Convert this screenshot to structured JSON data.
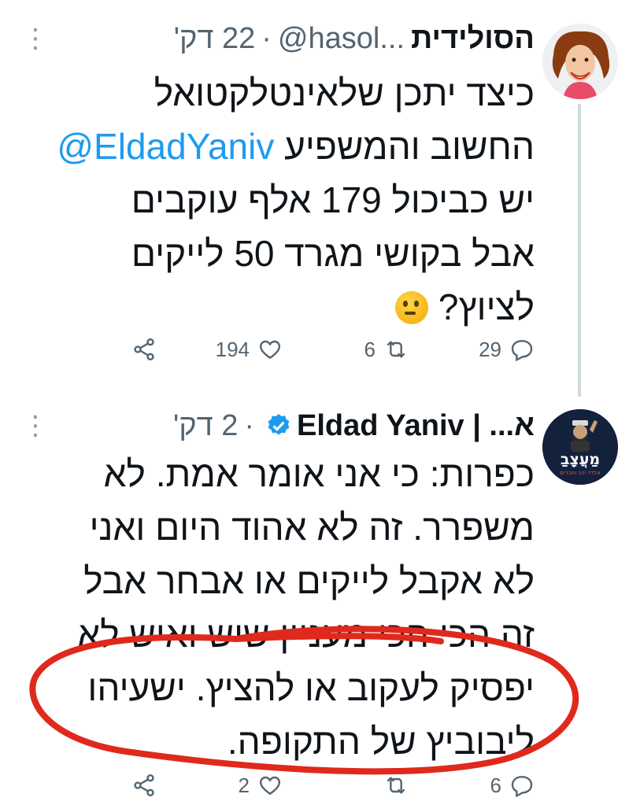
{
  "tweets": [
    {
      "display_name": "הסולידית",
      "handle": "@hasol...",
      "separator": "·",
      "time": "22 דק'",
      "text_lines": [
        "כיצד יתכן שלאינטלקטואל",
        "החשוב והמשפיע",
        "יש כביכול 179 אלף עוקבים",
        "אבל בקושי מגרד 50 לייקים",
        "לציוץ?"
      ],
      "mention": "@EldadYaniv",
      "emoji": "thinking-face",
      "reply_count": "29",
      "retweet_count": "6",
      "like_count": "194"
    },
    {
      "display_name": "א... | Eldad Yaniv",
      "verified": true,
      "separator": "·",
      "time": "2 דק'",
      "text_lines": [
        "כפרות: כי אני אומר אמת. לא",
        "משפרר. זה לא אהוד היום ואני",
        "לא אקבל לייקים או אבחר אבל",
        "זה הכי הכי מעניין שיש ואיש לא",
        "יפסיק לעקוב או להציץ. ישעיהו",
        "ליבוביץ של התקופה."
      ],
      "reply_count": "6",
      "retweet_count": "",
      "like_count": "2"
    }
  ],
  "avatar_logo_text": "מַעֲצָבַ",
  "avatar_logo_subtext": "אלדד יניב וחברים",
  "colors": {
    "link": "#1d9bf0",
    "verified": "#1d9bf0",
    "muted": "#536471",
    "annotation": "#e0291d"
  },
  "icons": [
    "more-icon",
    "reply-icon",
    "retweet-icon",
    "like-icon",
    "share-icon",
    "verified-icon",
    "thinking-face"
  ]
}
